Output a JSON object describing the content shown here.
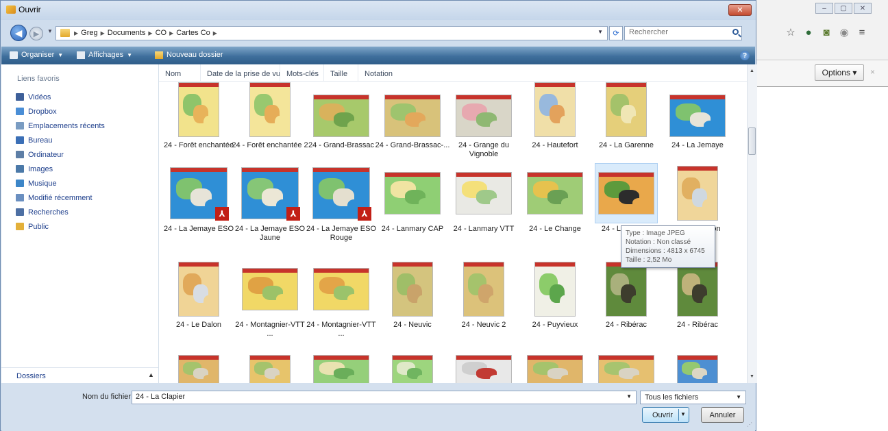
{
  "background_browser": {
    "options_label": "Options",
    "options_arrow": "▾",
    "close_glyph": "×",
    "window_controls": [
      "–",
      "▢",
      "✕"
    ],
    "toolbar_icons": [
      "star-icon",
      "globe-icon",
      "extension-icon",
      "eye-icon",
      "menu-icon"
    ]
  },
  "dialog": {
    "title": "Ouvrir",
    "close_label": "✕",
    "breadcrumbs": [
      "Greg",
      "Documents",
      "CO",
      "Cartes Co"
    ],
    "search_placeholder": "Rechercher",
    "toolbar": {
      "organize": "Organiser",
      "views": "Affichages",
      "new_folder": "Nouveau dossier",
      "help": "?"
    },
    "nav_header": "Liens favoris",
    "nav_items": [
      {
        "label": "Vidéos",
        "color": "#3d5f99"
      },
      {
        "label": "Dropbox",
        "color": "#4a8ed6"
      },
      {
        "label": "Emplacements récents",
        "color": "#7a9cc2"
      },
      {
        "label": "Bureau",
        "color": "#3b6fb6"
      },
      {
        "label": "Ordinateur",
        "color": "#5d7ea6"
      },
      {
        "label": "Images",
        "color": "#4b79a8"
      },
      {
        "label": "Musique",
        "color": "#3c86c8"
      },
      {
        "label": "Modifié récemment",
        "color": "#6a8fc0"
      },
      {
        "label": "Recherches",
        "color": "#4d6fa3"
      },
      {
        "label": "Public",
        "color": "#e3b03a"
      }
    ],
    "folders_label": "Dossiers",
    "columns": [
      "Nom",
      "Date de la prise de vue",
      "Mots-clés",
      "Taille",
      "Notation"
    ],
    "files": [
      {
        "name": "24 - Forêt enchantée",
        "row": 0,
        "col": 0,
        "pdf": false,
        "palette": [
          "#f2e38c",
          "#8fc46a",
          "#e8b35a"
        ]
      },
      {
        "name": "24 - Forêt enchantée 2",
        "row": 0,
        "col": 1,
        "pdf": false,
        "palette": [
          "#f4e59a",
          "#98c86f",
          "#e6ad58"
        ]
      },
      {
        "name": "24 - Grand-Brassac",
        "row": 0,
        "col": 2,
        "pdf": false,
        "palette": [
          "#a7c96b",
          "#d9b25c",
          "#6fa34c"
        ]
      },
      {
        "name": "24 - Grand-Brassac-...",
        "row": 0,
        "col": 3,
        "pdf": false,
        "palette": [
          "#d8c27a",
          "#9ec46e",
          "#e3a85b"
        ]
      },
      {
        "name": "24 - Grange du Vignoble",
        "row": 0,
        "col": 4,
        "pdf": false,
        "palette": [
          "#d9d6c8",
          "#e7a9b0",
          "#8fb873"
        ]
      },
      {
        "name": "24 - Hautefort",
        "row": 0,
        "col": 5,
        "pdf": false,
        "palette": [
          "#f0dfa8",
          "#98b9dd",
          "#e3a25c"
        ]
      },
      {
        "name": "24 - La Garenne",
        "row": 0,
        "col": 6,
        "pdf": false,
        "palette": [
          "#e5cf7a",
          "#a4c26a",
          "#f0e6b4"
        ]
      },
      {
        "name": "24 - La Jemaye",
        "row": 0,
        "col": 7,
        "pdf": false,
        "palette": [
          "#2f8fd6",
          "#7fc26f",
          "#e7e4d8"
        ]
      },
      {
        "name": "24 - La Jemaye ESO",
        "row": 1,
        "col": 0,
        "pdf": true,
        "palette": [
          "#2f8fd6",
          "#7fc26f",
          "#e7e4d8"
        ]
      },
      {
        "name": "24 - La Jemaye ESO Jaune",
        "row": 1,
        "col": 1,
        "pdf": true,
        "palette": [
          "#2f8fd6",
          "#86c677",
          "#ece7d6"
        ]
      },
      {
        "name": "24 - La Jemaye ESO Rouge",
        "row": 1,
        "col": 2,
        "pdf": true,
        "palette": [
          "#2f8fd6",
          "#7fc26f",
          "#e4dfcf"
        ]
      },
      {
        "name": "24 - Lanmary CAP",
        "row": 1,
        "col": 3,
        "pdf": false,
        "palette": [
          "#8fcf74",
          "#f0e4a2",
          "#6fb35a"
        ]
      },
      {
        "name": "24 - Lanmary VTT",
        "row": 1,
        "col": 4,
        "pdf": false,
        "palette": [
          "#e9e9e4",
          "#f4e07a",
          "#9fc98a"
        ]
      },
      {
        "name": "24 - Le Change",
        "row": 1,
        "col": 5,
        "pdf": false,
        "palette": [
          "#9fcc76",
          "#e6c24e",
          "#6aa054"
        ]
      },
      {
        "name": "24 - La Clapier",
        "row": 1,
        "col": 6,
        "pdf": false,
        "palette": [
          "#e9a84b",
          "#5d9a3c",
          "#2c2c2c"
        ],
        "selected": true
      },
      {
        "name": "24 - Le Deron",
        "row": 1,
        "col": 7,
        "pdf": false,
        "palette": [
          "#f0d69a",
          "#e1b061",
          "#cfd8e0"
        ]
      },
      {
        "name": "24 - Le Dalon",
        "row": 2,
        "col": 0,
        "pdf": false,
        "palette": [
          "#f0d496",
          "#e1a95a",
          "#d8dde3"
        ]
      },
      {
        "name": "24 - Montagnier-VTT ...",
        "row": 2,
        "col": 1,
        "pdf": false,
        "palette": [
          "#f1d866",
          "#e0a244",
          "#9cc268"
        ]
      },
      {
        "name": "24 - Montagnier-VTT ...",
        "row": 2,
        "col": 2,
        "pdf": false,
        "palette": [
          "#f1d866",
          "#e3a548",
          "#9bc36b"
        ]
      },
      {
        "name": "24 - Neuvic",
        "row": 2,
        "col": 3,
        "pdf": false,
        "palette": [
          "#d4c47e",
          "#9fbe68",
          "#c9a36a"
        ]
      },
      {
        "name": "24 - Neuvic 2",
        "row": 2,
        "col": 4,
        "pdf": false,
        "palette": [
          "#dcc27a",
          "#a5c36c",
          "#cfa56b"
        ]
      },
      {
        "name": "24 - Puyvieux",
        "row": 2,
        "col": 5,
        "pdf": false,
        "palette": [
          "#f0f0e6",
          "#8ccc6a",
          "#5ca64c"
        ]
      },
      {
        "name": "24 - Ribérac",
        "row": 2,
        "col": 6,
        "pdf": false,
        "palette": [
          "#5f8a3c",
          "#a9b07c",
          "#3d3d2d"
        ]
      },
      {
        "name": "24 - Ribérac",
        "row": 2,
        "col": 7,
        "pdf": false,
        "palette": [
          "#5f8a3c",
          "#bfb27a",
          "#3d3d2d"
        ]
      },
      {
        "name": "",
        "row": 3,
        "col": 0,
        "pdf": false,
        "palette": [
          "#e0b66a",
          "#a5c36c",
          "#d9d3c3"
        ]
      },
      {
        "name": "",
        "row": 3,
        "col": 1,
        "pdf": false,
        "palette": [
          "#e7c46b",
          "#a5c36c",
          "#d9d3c3"
        ]
      },
      {
        "name": "",
        "row": 3,
        "col": 2,
        "pdf": false,
        "palette": [
          "#95cf7a",
          "#e9e2b0",
          "#6aae5a"
        ]
      },
      {
        "name": "",
        "row": 3,
        "col": 3,
        "pdf": false,
        "palette": [
          "#9dd57e",
          "#dfe9c8",
          "#70b560"
        ]
      },
      {
        "name": "",
        "row": 3,
        "col": 4,
        "pdf": false,
        "palette": [
          "#e8e8e8",
          "#cfcfcf",
          "#c23a33"
        ]
      },
      {
        "name": "",
        "row": 3,
        "col": 5,
        "pdf": false,
        "palette": [
          "#e0b66a",
          "#a5c36c",
          "#d9d3c3"
        ]
      },
      {
        "name": "",
        "row": 3,
        "col": 6,
        "pdf": false,
        "palette": [
          "#e6c070",
          "#a7c46f",
          "#d9d3c3"
        ]
      },
      {
        "name": "",
        "row": 3,
        "col": 7,
        "pdf": false,
        "palette": [
          "#4d8fd2",
          "#94c870",
          "#dcd6c4"
        ]
      }
    ],
    "tooltip": {
      "type": "Type : Image JPEG",
      "rating": "Notation : Non classé",
      "dimensions": "Dimensions : 4813 x 6745",
      "size": "Taille : 2,52 Mo"
    },
    "filename_label": "Nom du fichier :",
    "filename_value": "24 - La Clapier",
    "filter_value": "Tous les fichiers",
    "open_label": "Ouvrir",
    "cancel_label": "Annuler"
  }
}
